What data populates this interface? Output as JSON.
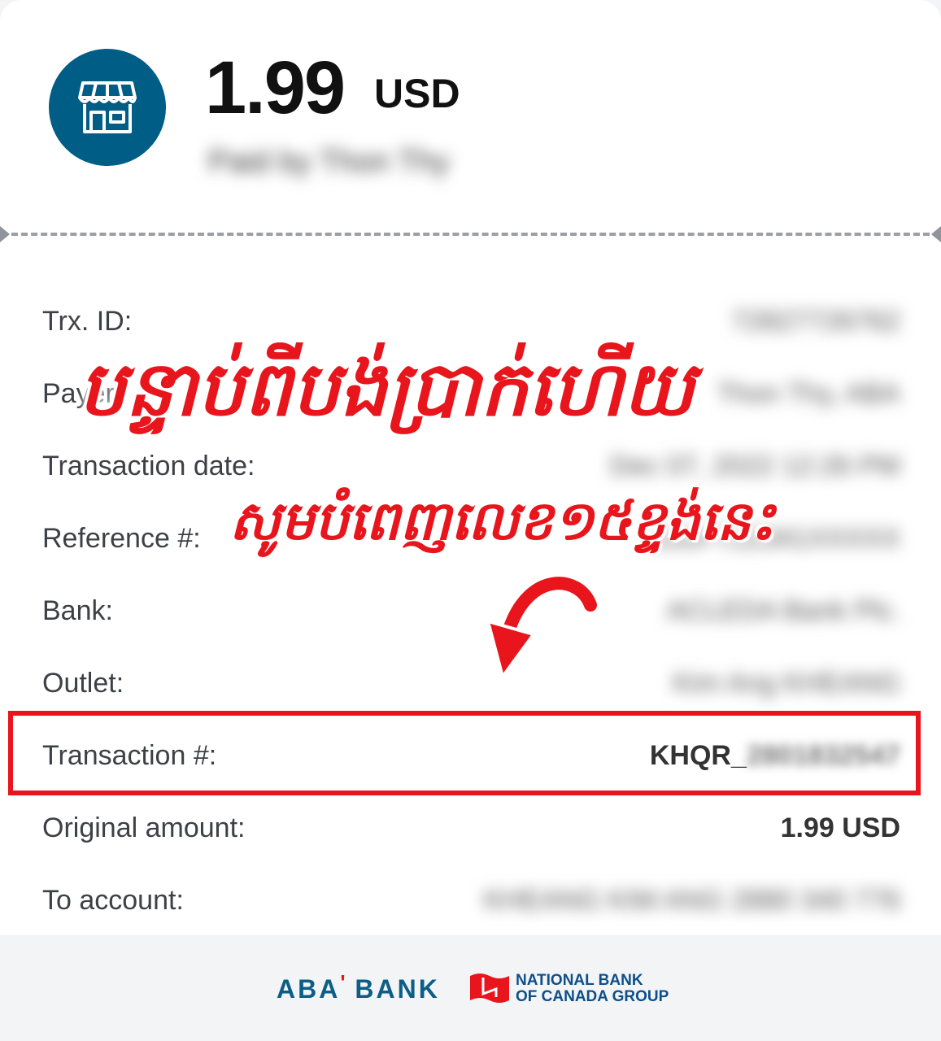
{
  "header": {
    "amount": "1.99",
    "currency": "USD",
    "paid_by": "Paid by Thon Thy"
  },
  "rows": [
    {
      "label": "Trx. ID:",
      "value": "72827726762"
    },
    {
      "label": "Payer:",
      "value": "Thon Thy, ABA"
    },
    {
      "label": "Transaction date:",
      "value": "Dec 07, 2022 12:26 PM"
    },
    {
      "label": "Reference #:",
      "value": "100FT22341XXXXX"
    },
    {
      "label": "Bank:",
      "value": "ACLEDA Bank Plc."
    },
    {
      "label": "Outlet:",
      "value": "Kim Ang KHEANG"
    },
    {
      "label": "Transaction #:",
      "value_prefix": "KHQR_",
      "value_number": "2801832547"
    },
    {
      "label": "Original amount:",
      "value": "1.99 USD"
    },
    {
      "label": "To account:",
      "value": "KHEANG KIM ANG 2880 340 776"
    }
  ],
  "overlay": {
    "title": "បន្ទាប់ពីបង់ប្រាក់ហើយ",
    "subtitle": "សូមបំពេញលេខ១៥ខ្ទង់នេះ",
    "accent_color": "#e8151c"
  },
  "footer": {
    "aba_logo": "ABA",
    "aba_apostrophe": "'",
    "aba_bank": "BANK",
    "nbc_line1": "NATIONAL BANK",
    "nbc_line2": "OF CANADA GROUP"
  },
  "colors": {
    "brand_blue": "#005d86",
    "highlight_red": "#e8151c"
  },
  "icons": [
    "store-icon",
    "curved-arrow-icon",
    "nbc-flag-icon"
  ]
}
